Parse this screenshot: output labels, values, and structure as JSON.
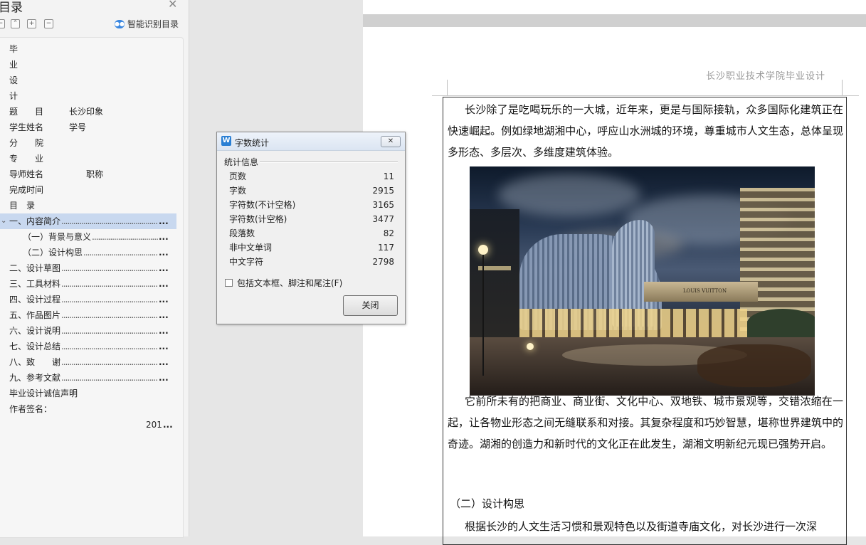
{
  "toc_panel": {
    "title": "目录",
    "smart_toc_label": "智能识别目录",
    "toolbar_buttons": [
      "collapse",
      "expand",
      "remove"
    ],
    "items": [
      {
        "label": "毕",
        "dots": false
      },
      {
        "label": "业",
        "dots": false
      },
      {
        "label": "设",
        "dots": false
      },
      {
        "label": "计",
        "dots": false
      },
      {
        "label": "题　　目　　　长沙印象",
        "dots": false
      },
      {
        "label": "学生姓名　　　学号",
        "dots": false
      },
      {
        "label": "分　　院",
        "dots": false
      },
      {
        "label": "专　　业",
        "dots": false
      },
      {
        "label": "导师姓名　　　　　职称",
        "dots": false
      },
      {
        "label": "完成时间",
        "dots": false
      },
      {
        "label": "目　录",
        "dots": false
      },
      {
        "label": "一、内容简介",
        "dots": true,
        "selected": true,
        "expanded": true
      },
      {
        "label": "（一）背景与意义",
        "dots": true,
        "indent": true
      },
      {
        "label": "（二）设计构思",
        "dots": true,
        "indent": true
      },
      {
        "label": "二、设计草图",
        "dots": true
      },
      {
        "label": "三、工具材料",
        "dots": true
      },
      {
        "label": "四、设计过程",
        "dots": true
      },
      {
        "label": "五、作品图片",
        "dots": true
      },
      {
        "label": "六、设计说明",
        "dots": true
      },
      {
        "label": "七、设计总结",
        "dots": true
      },
      {
        "label": "八、致　　谢",
        "dots": true
      },
      {
        "label": "九、参考文献",
        "dots": true
      },
      {
        "label": "毕业设计诚信声明",
        "dots": false
      },
      {
        "label": "作者签名：",
        "dots": false
      },
      {
        "label": "201",
        "dots": false,
        "right": true
      }
    ],
    "more_marker": "...",
    "dot_fill": "........................................................................"
  },
  "document": {
    "header_text": "长沙职业技术学院毕业设计",
    "paragraph1": "长沙除了是吃喝玩乐的一大城，近年来，更是与国际接轨，众多国际化建筑正在快速崛起。例如绿地湖湘中心，呼应山水洲城的环境，尊重城市人文生态，总体呈现多形态、多层次、多维度建筑体验。",
    "paragraph2": "它前所未有的把商业、商业街、文化中心、双地铁、城市景观等，交错浓缩在一起，让各物业形态之间无缝联系和对接。其复杂程度和巧妙智慧，堪称世界建筑中的奇迹。湖湘的创造力和新时代的文化正在此发生，湖湘文明新纪元现已强势开启。",
    "heading": "（二）设计构思",
    "paragraph3": "根据长沙的人文生活习惯和景观特色以及街道寺庙文化，对长沙进行一次深",
    "photo_sign_text": "LOUIS VUITTON"
  },
  "dialog": {
    "title": "字数统计",
    "group_label": "统计信息",
    "stats": [
      {
        "label": "页数",
        "value": "11"
      },
      {
        "label": "字数",
        "value": "2915"
      },
      {
        "label": "字符数(不计空格)",
        "value": "3165"
      },
      {
        "label": "字符数(计空格)",
        "value": "3477"
      },
      {
        "label": "段落数",
        "value": "82"
      },
      {
        "label": "非中文单词",
        "value": "117"
      },
      {
        "label": "中文字符",
        "value": "2798"
      }
    ],
    "checkbox_label": "包括文本框、脚注和尾注(F)",
    "checkbox_checked": false,
    "close_button": "关闭",
    "app_icon_letter": "W"
  },
  "colors": {
    "selection": "#c8d8ef",
    "accent": "#2a7fd4"
  }
}
